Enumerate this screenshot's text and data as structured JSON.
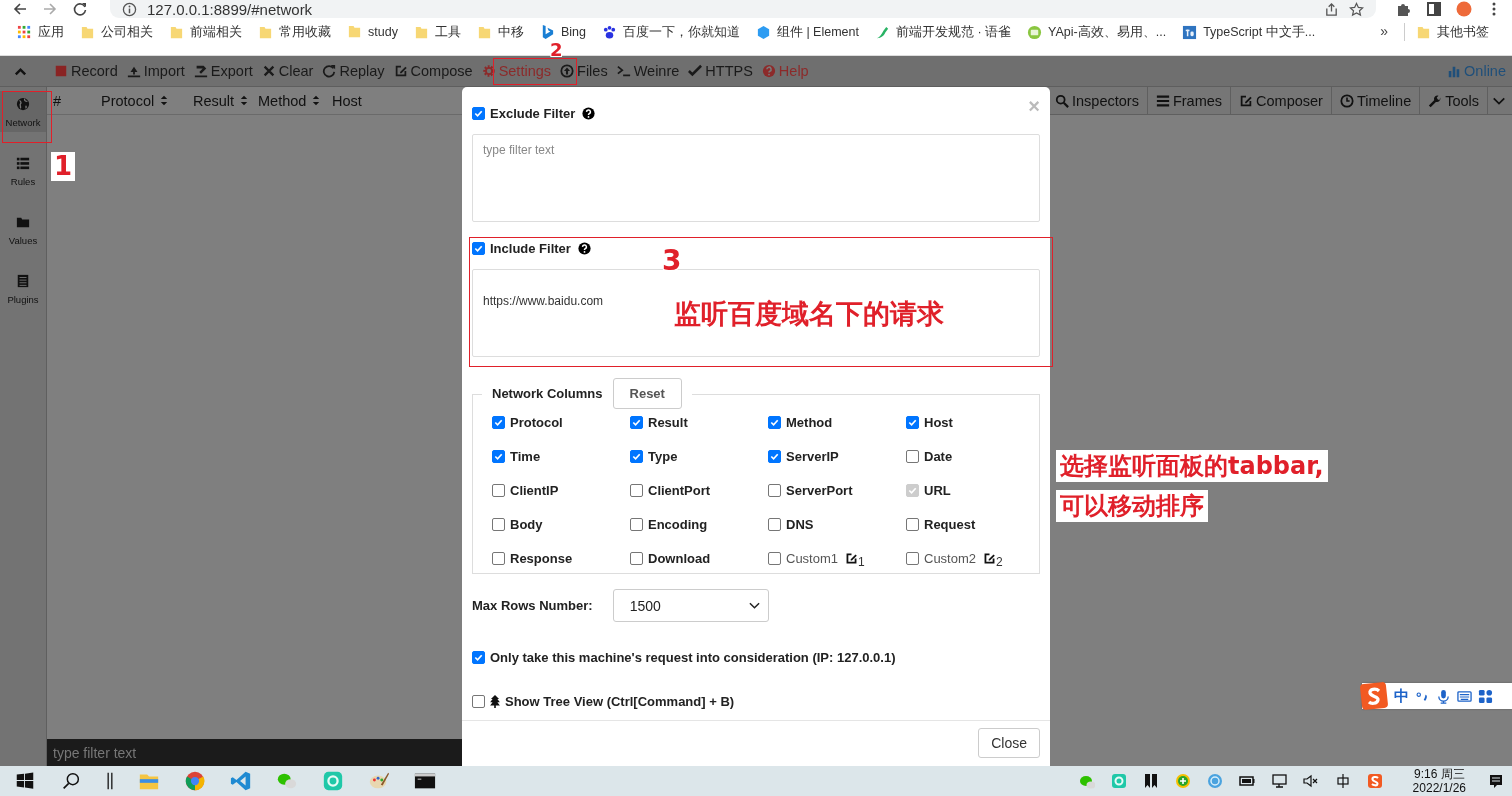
{
  "browser": {
    "url": "127.0.0.1:8899/#network"
  },
  "bookmarks": [
    {
      "label": "应用"
    },
    {
      "label": "公司相关"
    },
    {
      "label": "前端相关"
    },
    {
      "label": "常用收藏"
    },
    {
      "label": "study"
    },
    {
      "label": "工具"
    },
    {
      "label": "中移"
    },
    {
      "label": "Bing"
    },
    {
      "label": "百度一下，你就知道"
    },
    {
      "label": "组件 | Element"
    },
    {
      "label": "前端开发规范 · 语雀"
    },
    {
      "label": "YApi-高效、易用、..."
    },
    {
      "label": "TypeScript 中文手..."
    }
  ],
  "bookmarks_more": "»",
  "other_bookmarks": "其他书签",
  "toolbar": [
    {
      "label": "Record",
      "highlighted": false
    },
    {
      "label": "Import",
      "highlighted": false
    },
    {
      "label": "Export",
      "highlighted": false
    },
    {
      "label": "Clear",
      "highlighted": false
    },
    {
      "label": "Replay",
      "highlighted": false
    },
    {
      "label": "Compose",
      "highlighted": false
    },
    {
      "label": "Settings",
      "highlighted": true
    },
    {
      "label": "Files",
      "highlighted": false
    },
    {
      "label": "Weinre",
      "highlighted": false
    },
    {
      "label": "HTTPS",
      "highlighted": false
    },
    {
      "label": "Help",
      "highlighted": true
    }
  ],
  "online": "Online",
  "sidebar": [
    {
      "label": "Network",
      "selected": true
    },
    {
      "label": "Rules",
      "selected": false
    },
    {
      "label": "Values",
      "selected": false
    },
    {
      "label": "Plugins",
      "selected": false
    }
  ],
  "network_columns": [
    {
      "label": "#",
      "sortable": false
    },
    {
      "label": "Protocol",
      "sortable": true
    },
    {
      "label": "Result",
      "sortable": true
    },
    {
      "label": "Method",
      "sortable": true
    },
    {
      "label": "Host",
      "sortable": false
    }
  ],
  "right_tabs": [
    {
      "label": "Inspectors"
    },
    {
      "label": "Frames"
    },
    {
      "label": "Composer"
    },
    {
      "label": "Timeline"
    },
    {
      "label": "Tools"
    }
  ],
  "filter_placeholder": "type filter text",
  "settings_dialog": {
    "exclude_filter": {
      "label": "Exclude Filter",
      "checked": true,
      "placeholder": "type filter text"
    },
    "include_filter": {
      "label": "Include Filter",
      "checked": true,
      "value": "https://www.baidu.com"
    },
    "columns_title": "Network Columns",
    "reset": "Reset",
    "columns": [
      {
        "label": "Protocol",
        "checked": true,
        "disabled": false,
        "kind": "plain"
      },
      {
        "label": "Result",
        "checked": true,
        "disabled": false,
        "kind": "plain"
      },
      {
        "label": "Method",
        "checked": true,
        "disabled": false,
        "kind": "plain"
      },
      {
        "label": "Host",
        "checked": true,
        "disabled": false,
        "kind": "plain"
      },
      {
        "label": "Time",
        "checked": true,
        "disabled": false,
        "kind": "plain"
      },
      {
        "label": "Type",
        "checked": true,
        "disabled": false,
        "kind": "plain"
      },
      {
        "label": "ServerIP",
        "checked": true,
        "disabled": false,
        "kind": "plain"
      },
      {
        "label": "Date",
        "checked": false,
        "disabled": false,
        "kind": "plain"
      },
      {
        "label": "ClientIP",
        "checked": false,
        "disabled": false,
        "kind": "plain"
      },
      {
        "label": "ClientPort",
        "checked": false,
        "disabled": false,
        "kind": "plain"
      },
      {
        "label": "ServerPort",
        "checked": false,
        "disabled": false,
        "kind": "plain"
      },
      {
        "label": "URL",
        "checked": true,
        "disabled": true,
        "kind": "plain"
      },
      {
        "label": "Body",
        "checked": false,
        "disabled": false,
        "kind": "plain"
      },
      {
        "label": "Encoding",
        "checked": false,
        "disabled": false,
        "kind": "plain"
      },
      {
        "label": "DNS",
        "checked": false,
        "disabled": false,
        "kind": "plain"
      },
      {
        "label": "Request",
        "checked": false,
        "disabled": false,
        "kind": "plain"
      },
      {
        "label": "Response",
        "checked": false,
        "disabled": false,
        "kind": "plain"
      },
      {
        "label": "Download",
        "checked": false,
        "disabled": false,
        "kind": "plain"
      },
      {
        "label": "Custom1",
        "checked": false,
        "disabled": false,
        "kind": "custom",
        "edit_label": "1"
      },
      {
        "label": "Custom2",
        "checked": false,
        "disabled": false,
        "kind": "custom",
        "edit_label": "2"
      }
    ],
    "max_rows_label": "Max Rows Number:",
    "max_rows_value": "1500",
    "options": [
      {
        "label": "Only take this machine's request into consideration (IP: 127.0.0.1)",
        "checked": true,
        "kind": "plain"
      },
      {
        "label": "Show Tree View (Ctrl[Command] + B)",
        "checked": false,
        "kind": "tree"
      }
    ],
    "close_button": "Close",
    "close_mark": "×"
  },
  "ime": {
    "mode": "中"
  },
  "taskbar": {
    "time": "9:16 周三",
    "date": "2022/1/26"
  },
  "annotations": [
    {
      "text": "1"
    },
    {
      "text": "2"
    },
    {
      "text": "3"
    },
    {
      "text": "监听百度域名下的请求"
    },
    {
      "text": "选择监听面板的tabbar,"
    },
    {
      "text": "可以移动排序"
    }
  ]
}
